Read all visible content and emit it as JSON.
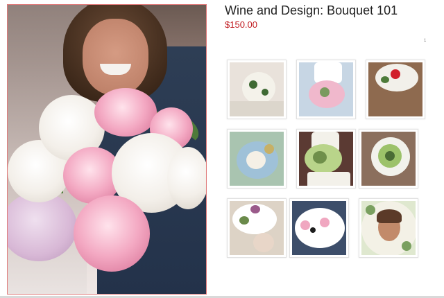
{
  "product": {
    "title": "Wine and Design: Bouquet 101",
    "price": "$150.00",
    "gallery_page": "1"
  },
  "main_image": {
    "alt": "bride holding pink and white peony bouquet"
  },
  "thumbnails": [
    {
      "alt": "white rose bouquet over lace dress",
      "bg": "#e9e2db",
      "colors": [
        "#f4f2ea",
        "#3f6a34",
        "#dcd6cc"
      ]
    },
    {
      "alt": "pink peony bouquet in bride's hands",
      "bg": "#c7d6e4",
      "colors": [
        "#f0b8cc",
        "#ffffff",
        "#7a9a5e"
      ]
    },
    {
      "alt": "red and white bouquet on wooden floor",
      "bg": "#8e6a4f",
      "colors": [
        "#d1202c",
        "#f2f0ea",
        "#4d7b3a"
      ]
    },
    {
      "alt": "pastel bouquet with blue hydrangea",
      "bg": "#a9c4b0",
      "colors": [
        "#f5f0e6",
        "#9fc1d8",
        "#c7b066"
      ]
    },
    {
      "alt": "green hydrangea bouquet with lace gown",
      "bg": "#5b3a33",
      "colors": [
        "#b9d48a",
        "#f3f1ea",
        "#6f8f4a"
      ]
    },
    {
      "alt": "green bouquet held by bride",
      "bg": "#8b6f5d",
      "colors": [
        "#f2f2ec",
        "#9cc26a",
        "#4a6b35"
      ]
    },
    {
      "alt": "purple and white cascading bouquet",
      "bg": "#ddd3c6",
      "colors": [
        "#9a5a8a",
        "#ffffff",
        "#6a8a4a"
      ]
    },
    {
      "alt": "anemone and pink rose bouquet",
      "bg": "#3d4e6a",
      "colors": [
        "#ffffff",
        "#f0a7c0",
        "#1d1d1d"
      ]
    },
    {
      "alt": "bride surrounded by white flowers",
      "bg": "#dfe8cf",
      "colors": [
        "#f3f1e6",
        "#7aa060",
        "#c28a6a"
      ]
    }
  ]
}
